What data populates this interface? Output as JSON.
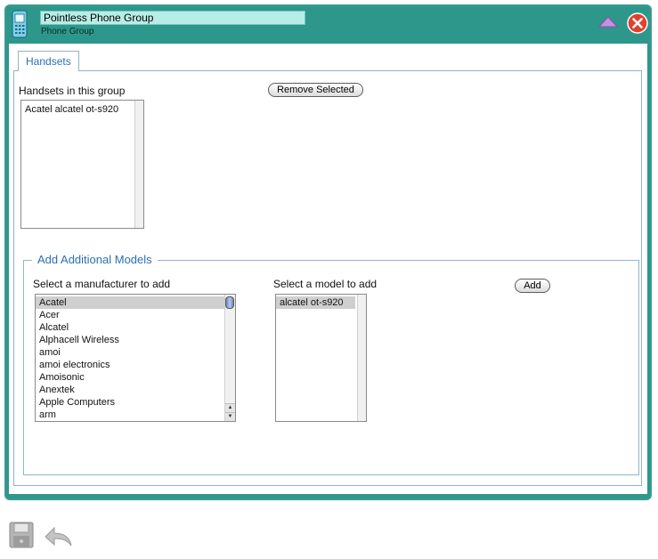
{
  "header": {
    "title_value": "Pointless Phone Group",
    "subtitle": "Phone Group",
    "icons": {
      "app": "mobile-phone-icon",
      "collapse": "triangle-up-icon",
      "close": "close-x-icon"
    }
  },
  "tabs": [
    {
      "label": "Handsets",
      "active": true
    }
  ],
  "handsets": {
    "list_label": "Handsets in this group",
    "items": [
      "Acatel alcatel ot-s920"
    ],
    "remove_label": "Remove Selected"
  },
  "add_models": {
    "legend": "Add Additional Models",
    "manufacturer_label": "Select a manufacturer to add",
    "manufacturers": [
      "Acatel",
      "Acer",
      "Alcatel",
      "Alphacell Wireless",
      "amoi",
      "amoi electronics",
      "Amoisonic",
      "Anextek",
      "Apple Computers",
      "arm"
    ],
    "selected_manufacturer": "Acatel",
    "model_label": "Select a model to add",
    "models": [
      "alcatel ot-s920"
    ],
    "selected_model": "alcatel ot-s920",
    "add_label": "Add"
  },
  "footer": {
    "icons": [
      "save-disk-icon",
      "undo-arrow-icon"
    ]
  },
  "colors": {
    "titlebar": "#2e978c",
    "accent_text": "#2a6fb5",
    "selection": "#cfcfcf"
  }
}
